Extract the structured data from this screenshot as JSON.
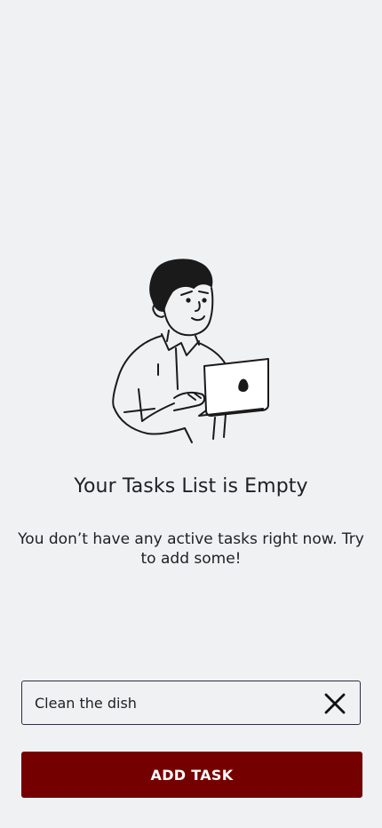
{
  "empty_state": {
    "illustration": "person-with-laptop-illustration",
    "title": "Your Tasks List is Empty",
    "message": "You don’t have any active tasks right now. Try to add some!"
  },
  "task_input": {
    "value": "Clean the dish",
    "clear_icon": "close-icon"
  },
  "add_button": {
    "label": "ADD TASK"
  },
  "colors": {
    "background": "#f0f1f3",
    "primary": "#750000",
    "text": "#1f1f24",
    "input_border": "#2a2f45"
  }
}
